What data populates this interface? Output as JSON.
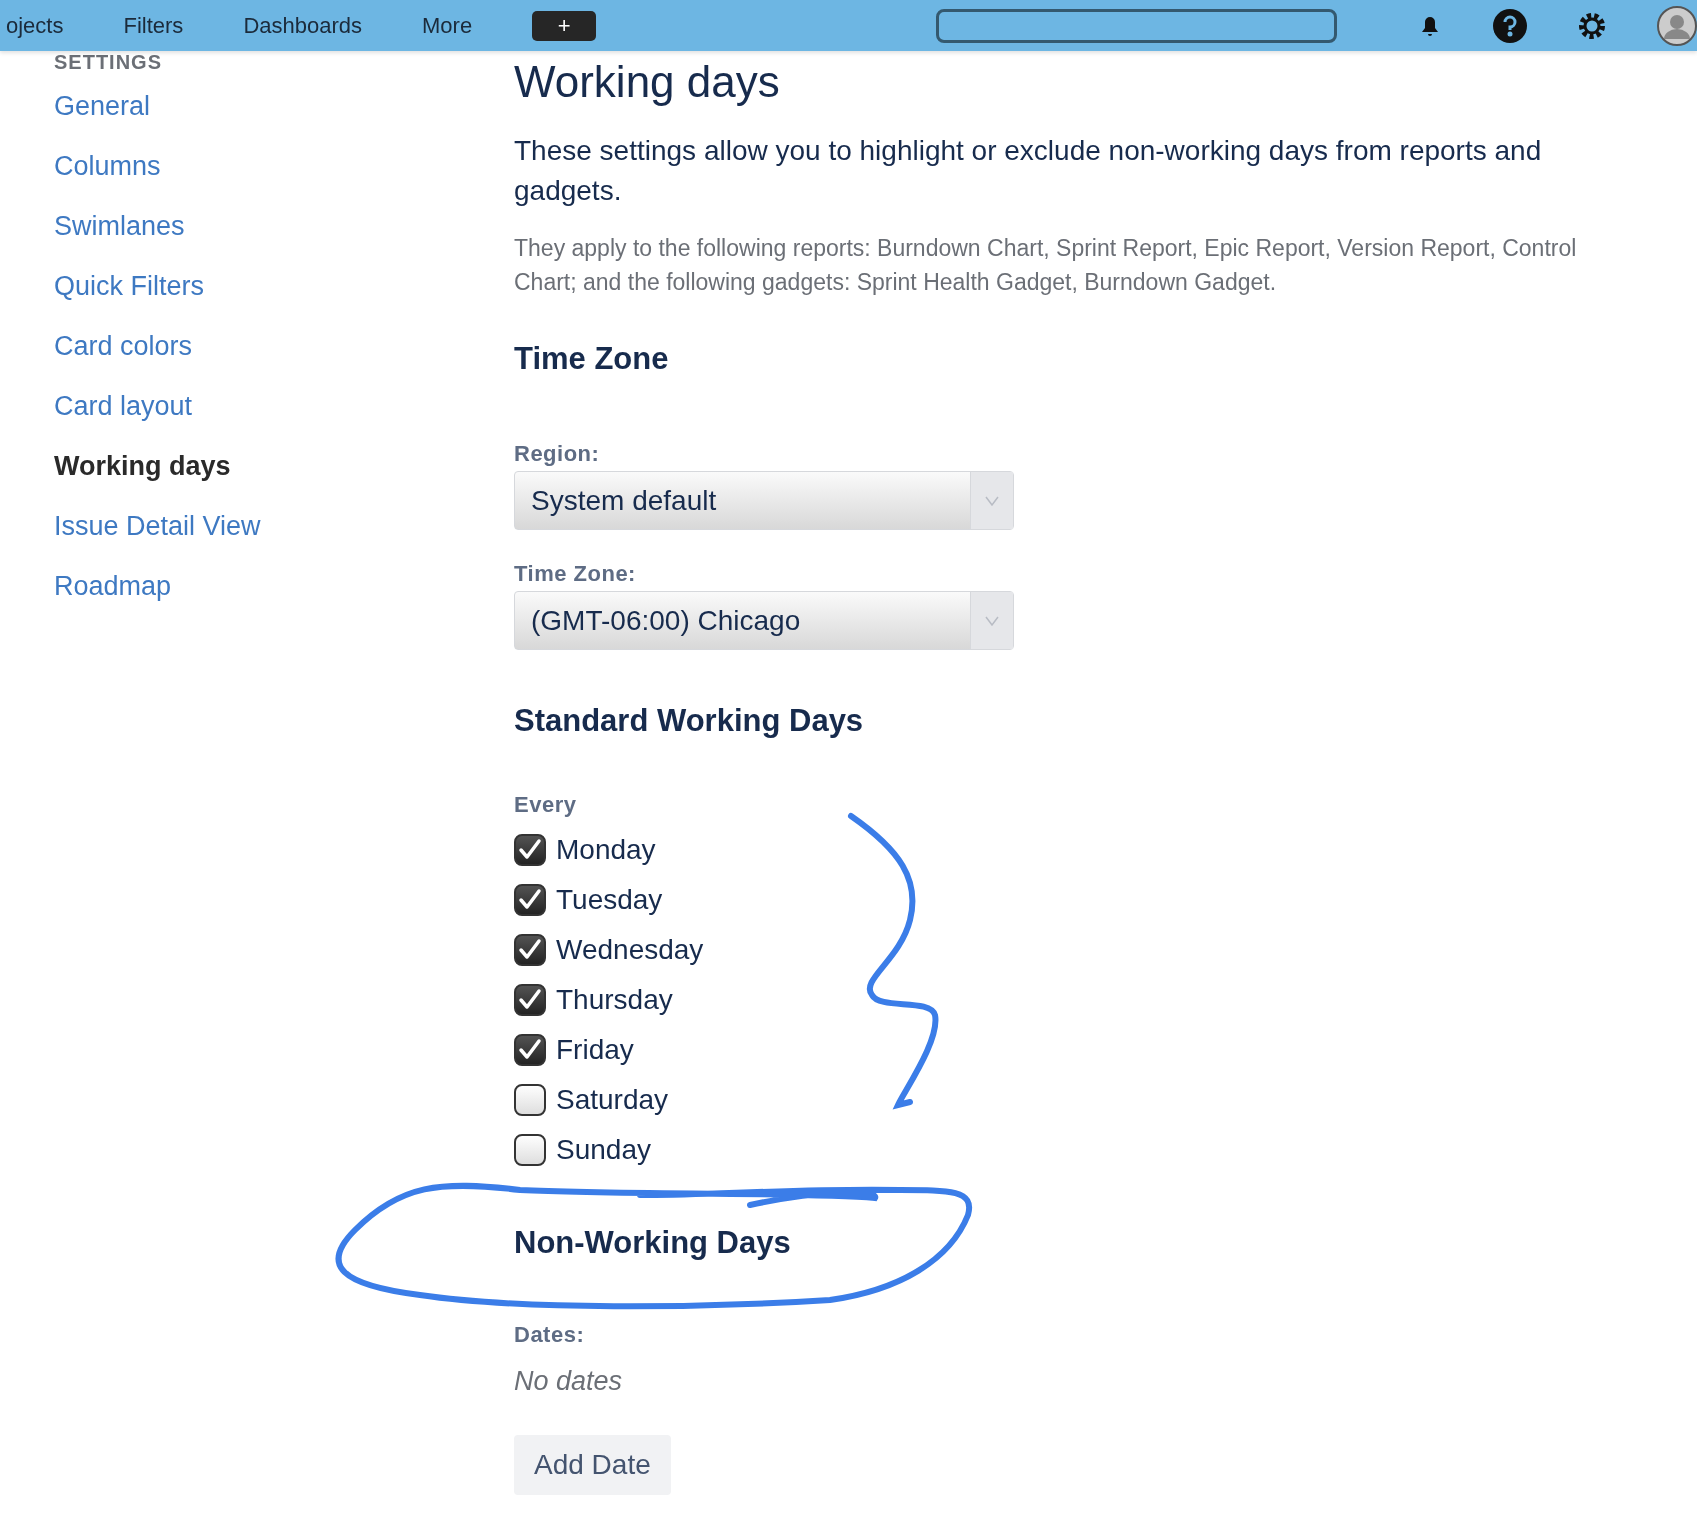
{
  "nav": {
    "items": [
      "ojects",
      "Filters",
      "Dashboards",
      "More"
    ],
    "create_button": "+"
  },
  "sidebar": {
    "heading": "SETTINGS",
    "items": [
      {
        "label": "General",
        "selected": false
      },
      {
        "label": "Columns",
        "selected": false
      },
      {
        "label": "Swimlanes",
        "selected": false
      },
      {
        "label": "Quick Filters",
        "selected": false
      },
      {
        "label": "Card colors",
        "selected": false
      },
      {
        "label": "Card layout",
        "selected": false
      },
      {
        "label": "Working days",
        "selected": true
      },
      {
        "label": "Issue Detail View",
        "selected": false
      },
      {
        "label": "Roadmap",
        "selected": false
      }
    ]
  },
  "page": {
    "title": "Working days",
    "intro": "These settings allow you to highlight or exclude non-working days from reports and gadgets.",
    "note": "They apply to the following reports: Burndown Chart, Sprint Report, Epic Report, Version Report, Control Chart; and the following gadgets: Sprint Health Gadget, Burndown Gadget.",
    "time_zone": {
      "heading": "Time Zone",
      "fields": [
        {
          "label": "Region:",
          "value": "System default"
        },
        {
          "label": "Time Zone:",
          "value": "(GMT-06:00) Chicago"
        }
      ]
    },
    "standard": {
      "heading": "Standard Working Days",
      "label": "Every",
      "days": [
        {
          "label": "Monday",
          "checked": true
        },
        {
          "label": "Tuesday",
          "checked": true
        },
        {
          "label": "Wednesday",
          "checked": true
        },
        {
          "label": "Thursday",
          "checked": true
        },
        {
          "label": "Friday",
          "checked": true
        },
        {
          "label": "Saturday",
          "checked": false
        },
        {
          "label": "Sunday",
          "checked": false
        }
      ]
    },
    "non_working": {
      "heading": "Non-Working Days",
      "dates_label": "Dates:",
      "empty": "No dates",
      "add_button": "Add Date"
    }
  }
}
